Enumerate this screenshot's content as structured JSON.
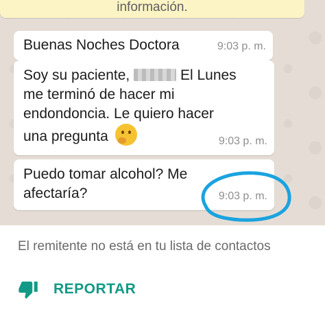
{
  "system_notice": {
    "text": "información."
  },
  "messages": [
    {
      "lines": [
        "Buenas Noches Doctora"
      ],
      "time": "9:03 p. m."
    },
    {
      "line1_before": "Soy su paciente,",
      "line1_after": "El Lunes",
      "lines_rest": [
        "me terminó de hacer mi",
        "endondoncia. Le quiero hacer",
        "una pregunta"
      ],
      "emoji": "thinking-face",
      "time": "9:03 p. m."
    },
    {
      "lines": [
        "Puedo tomar alcohol? Me",
        "afectaría?"
      ],
      "time": "9:03 p. m."
    }
  ],
  "footer": {
    "notice": "El remitente no está en tu lista de contactos",
    "report_label": "REPORTAR"
  },
  "colors": {
    "chat_bg": "#e5ddd5",
    "accent": "#129a86",
    "annotation": "#1aa3e0"
  }
}
